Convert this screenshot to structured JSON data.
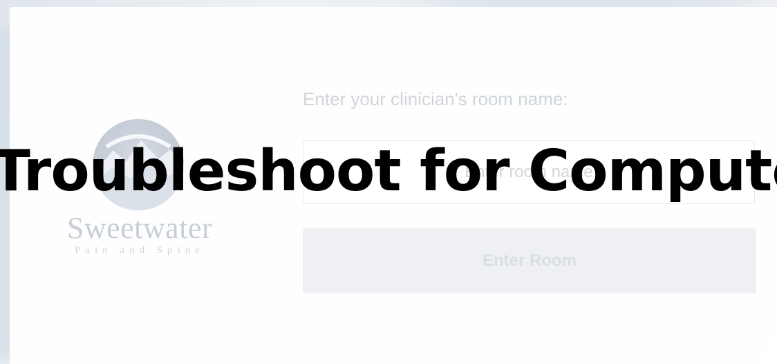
{
  "overlay": {
    "title": "Troubleshoot for Computer"
  },
  "logo": {
    "name": "Sweetwater",
    "subtitle": "Pain and Spine",
    "icon": "mountain-sun-icon"
  },
  "form": {
    "label": "Enter your clinician's room name:",
    "input_placeholder": "Enter room name",
    "input_value": "",
    "submit_label": "Enter Room"
  },
  "colors": {
    "background": "#e6ebf0",
    "card": "#ffffff",
    "label_text": "#c2c6cc",
    "button_bg": "#eef0f3",
    "button_text": "#dadde2",
    "logo_blue": "#4e6682",
    "overlay_text": "#000000"
  }
}
